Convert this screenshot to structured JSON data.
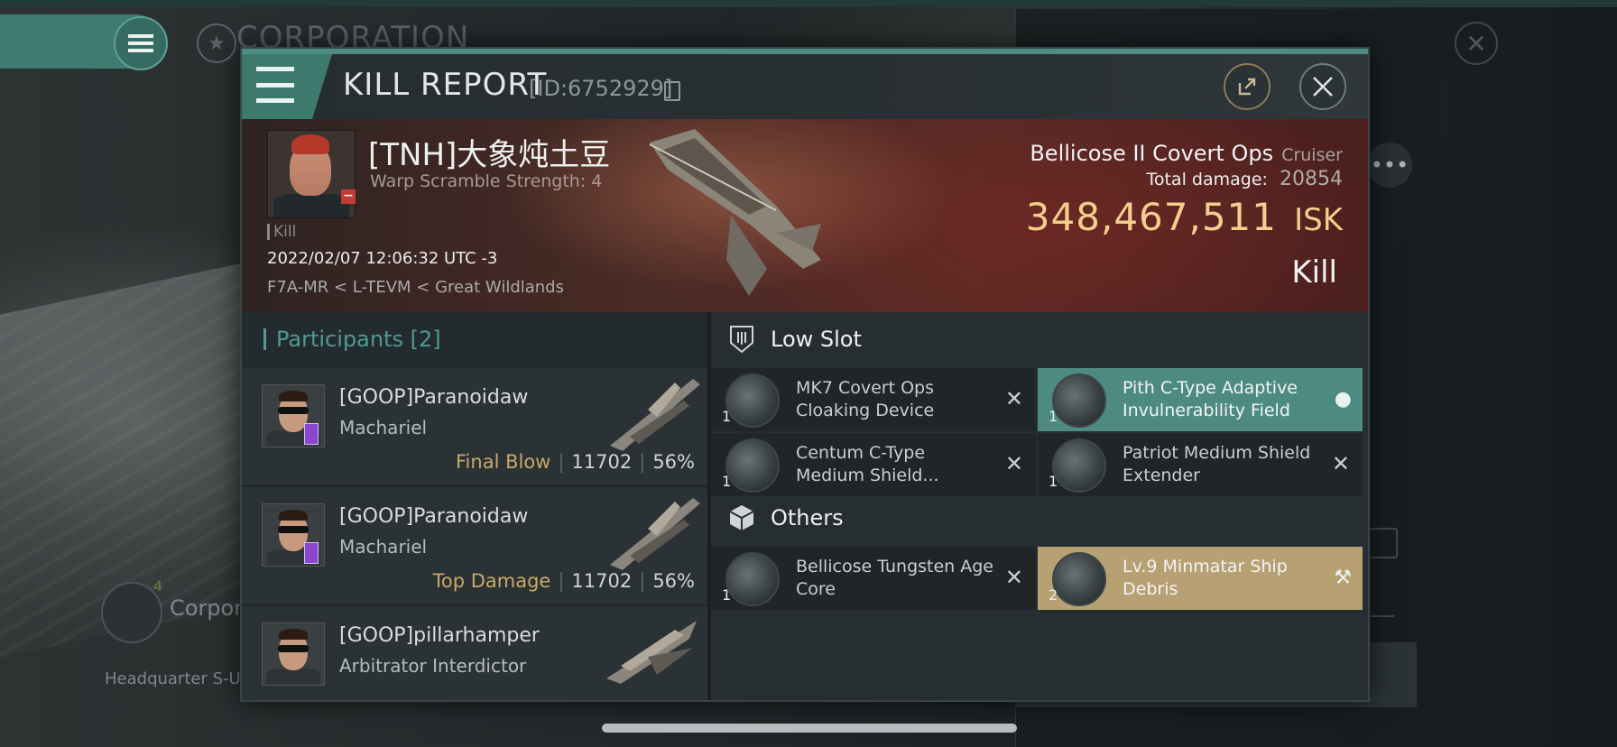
{
  "background": {
    "corp_title": "CORPORATION",
    "corp_label": "Corpora",
    "hq_label": "Headquarter S-U",
    "corp_badge": "4"
  },
  "header": {
    "title": "KILL REPORT",
    "id_text": "[ID:6752929]"
  },
  "victim": {
    "name": "[TNH]大象炖土豆",
    "warp_text": "Warp Scramble Strength: 4",
    "kill_tag": "Kill",
    "datetime": "2022/02/07 12:06:32 UTC -3",
    "location": "F7A-MR < L-TEVM < Great Wildlands",
    "ship_name": "Bellicose II Covert Ops",
    "ship_class": "Cruiser",
    "total_damage_label": "Total damage:",
    "total_damage": "20854",
    "isk_value": "348,467,511",
    "isk_unit": "ISK",
    "result": "Kill"
  },
  "participants": {
    "title": "Participants",
    "count": "[2]",
    "rows": [
      {
        "name": "[GOOP]Paranoidaw",
        "ship": "Machariel",
        "tag": "Final Blow",
        "damage": "11702",
        "percent": "56%"
      },
      {
        "name": "[GOOP]Paranoidaw",
        "ship": "Machariel",
        "tag": "Top Damage",
        "damage": "11702",
        "percent": "56%"
      },
      {
        "name": "[GOOP]pillarhamper",
        "ship": "Arbitrator Interdictor"
      }
    ]
  },
  "fitting": {
    "low_slot_label": "Low Slot",
    "others_label": "Others",
    "low_slot": [
      {
        "qty": "1",
        "name": "MK7 Covert Ops Cloaking Device"
      },
      {
        "qty": "1",
        "name": "Pith C-Type Adaptive Invulnerability Field"
      },
      {
        "qty": "1",
        "name": "Centum C-Type Medium Shield..."
      },
      {
        "qty": "1",
        "name": "Patriot Medium Shield Extender"
      }
    ],
    "others": [
      {
        "qty": "1",
        "name": "Bellicose Tungsten Age Core"
      },
      {
        "qty": "2",
        "name": "Lv.9 Minmatar Ship Debris"
      }
    ]
  },
  "colors": {
    "accent_teal": "#4f9a94",
    "isk_gold": "#f3cf8e",
    "highlight_gold": "#b7a173",
    "highlight_teal": "#4d8b82"
  }
}
